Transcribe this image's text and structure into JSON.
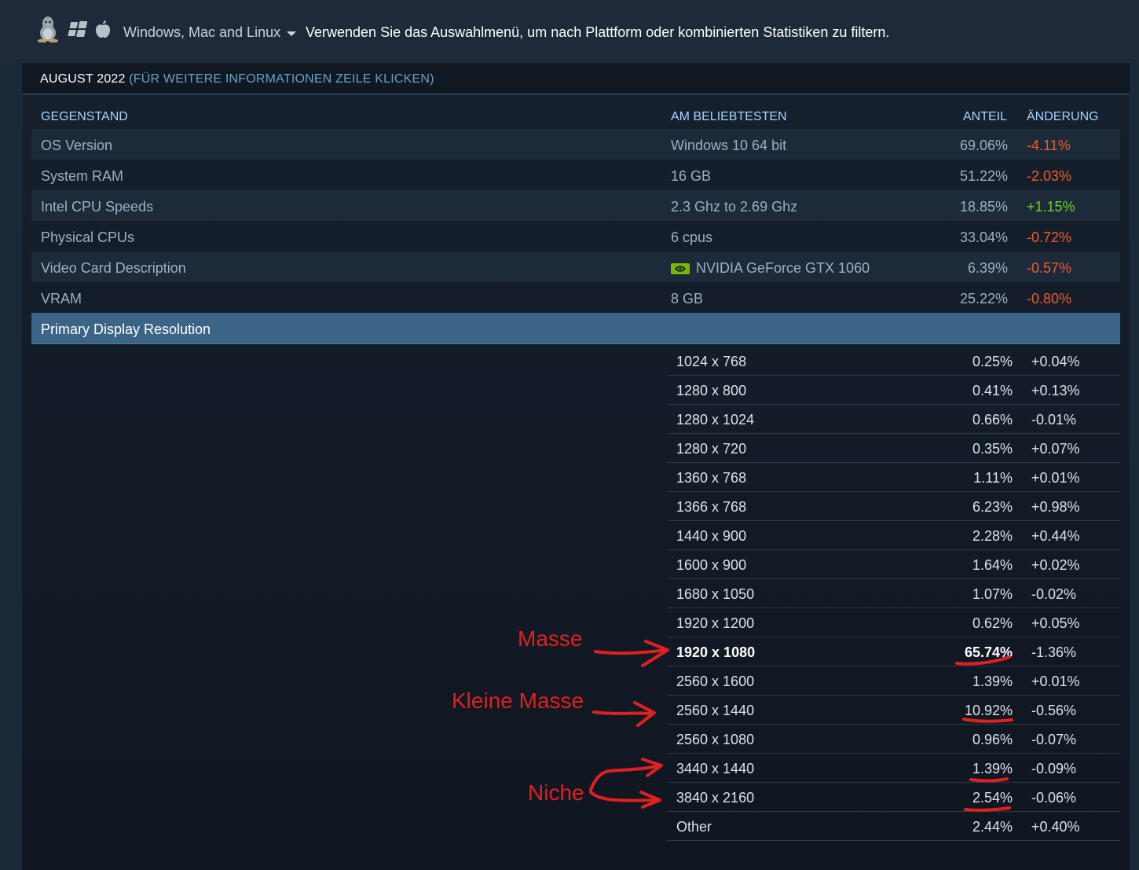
{
  "filter": {
    "platform_label": "Windows, Mac and Linux",
    "hint": "Verwenden Sie das Auswahlmenü, um nach Plattform oder kombinierten Statistiken zu filtern."
  },
  "month": {
    "label": "AUGUST 2022",
    "hint": "(FÜR WEITERE INFORMATIONEN ZEILE KLICKEN)"
  },
  "table": {
    "headers": {
      "item": "GEGENSTAND",
      "popular": "AM BELIEBTESTEN",
      "share": "ANTEIL",
      "change": "ÄNDERUNG"
    },
    "rows": [
      {
        "item": "OS Version",
        "popular": "Windows 10 64 bit",
        "share": "69.06%",
        "change": "-4.11%"
      },
      {
        "item": "System RAM",
        "popular": "16 GB",
        "share": "51.22%",
        "change": "-2.03%"
      },
      {
        "item": "Intel CPU Speeds",
        "popular": "2.3 Ghz to 2.69 Ghz",
        "share": "18.85%",
        "change": "+1.15%"
      },
      {
        "item": "Physical CPUs",
        "popular": "6 cpus",
        "share": "33.04%",
        "change": "-0.72%"
      },
      {
        "item": "Video Card Description",
        "popular": "NVIDIA GeForce GTX 1060",
        "share": "6.39%",
        "change": "-0.57%"
      },
      {
        "item": "VRAM",
        "popular": "8 GB",
        "share": "25.22%",
        "change": "-0.80%"
      }
    ],
    "expanded_section": "Primary Display Resolution",
    "resolutions": [
      {
        "name": "1024 x 768",
        "share": "0.25%",
        "change": "+0.04%"
      },
      {
        "name": "1280 x 800",
        "share": "0.41%",
        "change": "+0.13%"
      },
      {
        "name": "1280 x 1024",
        "share": "0.66%",
        "change": "-0.01%"
      },
      {
        "name": "1280 x 720",
        "share": "0.35%",
        "change": "+0.07%"
      },
      {
        "name": "1360 x 768",
        "share": "1.11%",
        "change": "+0.01%"
      },
      {
        "name": "1366 x 768",
        "share": "6.23%",
        "change": "+0.98%"
      },
      {
        "name": "1440 x 900",
        "share": "2.28%",
        "change": "+0.44%"
      },
      {
        "name": "1600 x 900",
        "share": "1.64%",
        "change": "+0.02%"
      },
      {
        "name": "1680 x 1050",
        "share": "1.07%",
        "change": "-0.02%"
      },
      {
        "name": "1920 x 1200",
        "share": "0.62%",
        "change": "+0.05%"
      },
      {
        "name": "1920 x 1080",
        "share": "65.74%",
        "change": "-1.36%"
      },
      {
        "name": "2560 x 1600",
        "share": "1.39%",
        "change": "+0.01%"
      },
      {
        "name": "2560 x 1440",
        "share": "10.92%",
        "change": "-0.56%"
      },
      {
        "name": "2560 x 1080",
        "share": "0.96%",
        "change": "-0.07%"
      },
      {
        "name": "3440 x 1440",
        "share": "1.39%",
        "change": "-0.09%"
      },
      {
        "name": "3840 x 2160",
        "share": "2.54%",
        "change": "-0.06%"
      },
      {
        "name": "Other",
        "share": "2.44%",
        "change": "+0.40%"
      }
    ]
  },
  "annotations": {
    "masse": "Masse",
    "kleine_masse": "Kleine Masse",
    "niche": "Niche"
  },
  "colors": {
    "positive": "#6fd12b",
    "negative": "#ee5a2a",
    "annotation": "#e02020",
    "header_text": "#a4d4ff",
    "section_bg": "#3b6486"
  },
  "icons": [
    "linux-icon",
    "windows-icon",
    "apple-icon",
    "nvidia-icon",
    "caret-down-icon"
  ]
}
